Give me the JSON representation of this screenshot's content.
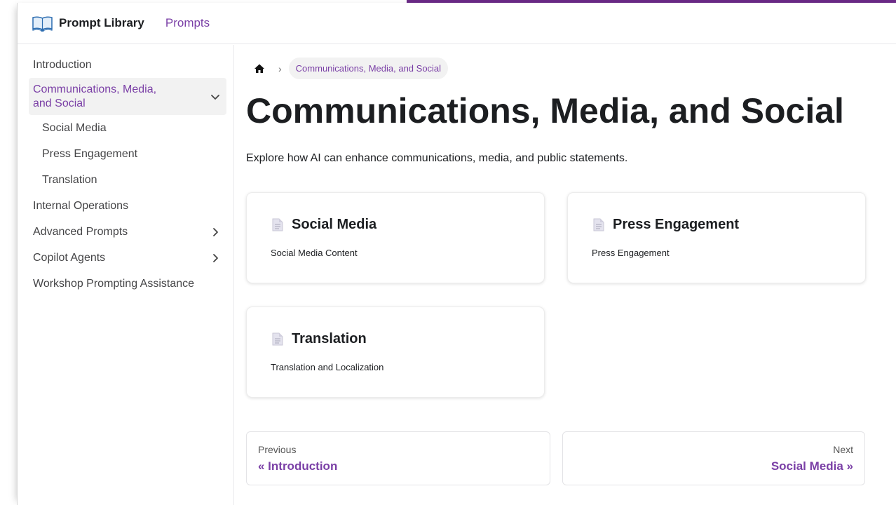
{
  "navbar": {
    "title": "Prompt Library",
    "link": "Prompts"
  },
  "sidebar": {
    "items": [
      {
        "label": "Introduction"
      },
      {
        "label": "Communications, Media, and Social",
        "active": true,
        "expanded": true
      },
      {
        "label": "Social Media",
        "sub": true
      },
      {
        "label": "Press Engagement",
        "sub": true
      },
      {
        "label": "Translation",
        "sub": true
      },
      {
        "label": "Internal Operations"
      },
      {
        "label": "Advanced Prompts",
        "collapsible": true
      },
      {
        "label": "Copilot Agents",
        "collapsible": true
      },
      {
        "label": "Workshop Prompting Assistance"
      }
    ]
  },
  "breadcrumb": {
    "current": "Communications, Media, and Social",
    "separator": "›"
  },
  "page": {
    "title": "Communications, Media, and Social",
    "description": "Explore how AI can enhance communications, media, and public statements."
  },
  "cards": [
    {
      "title": "Social Media",
      "description": "Social Media Content"
    },
    {
      "title": "Press Engagement",
      "description": "Press Engagement"
    },
    {
      "title": "Translation",
      "description": "Translation and Localization"
    }
  ],
  "pagination": {
    "previous": {
      "label": "Previous",
      "link": "« Introduction"
    },
    "next": {
      "label": "Next",
      "link": "Social Media »"
    }
  },
  "colors": {
    "accent": "#7a3fa6",
    "top_bar": "#6b2a87",
    "active_bg": "#f2f2f2"
  }
}
